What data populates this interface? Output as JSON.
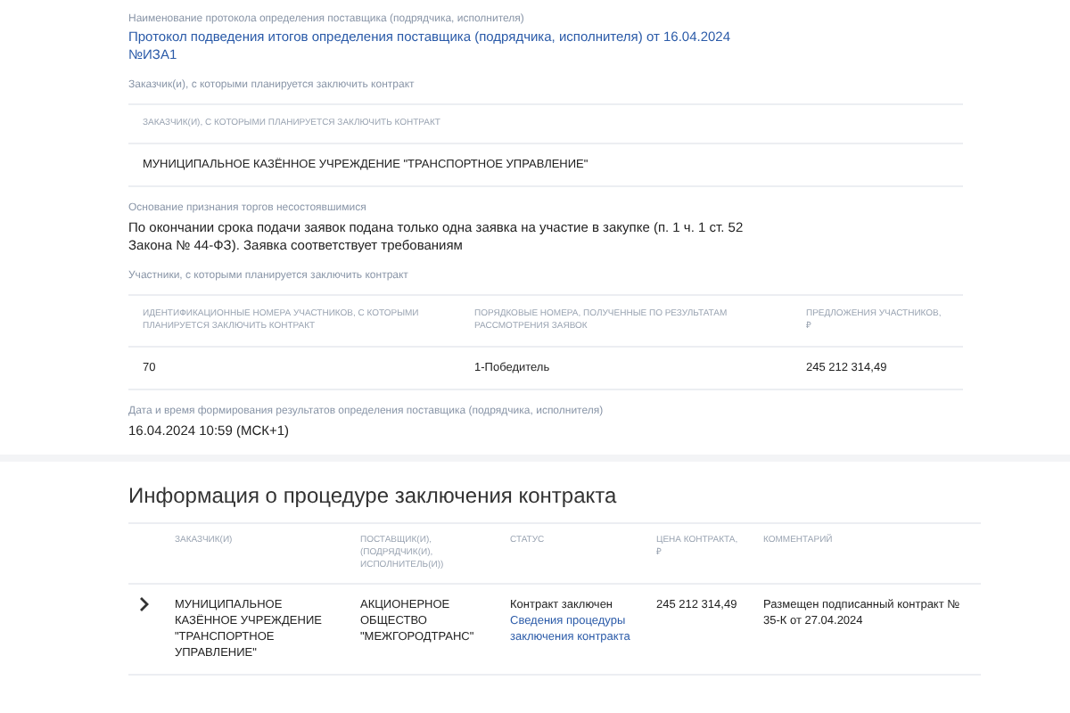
{
  "protocol": {
    "label": "Наименование протокола определения поставщика (подрядчика, исполнителя)",
    "link": "Протокол подведения итогов определения поставщика (подрядчика, исполнителя) от 16.04.2024 №ИЗА1"
  },
  "customers": {
    "label": "Заказчик(и), с которыми планируется заключить контракт",
    "columns": [
      "ЗАКАЗЧИК(И), С КОТОРЫМИ ПЛАНИРУЕТСЯ ЗАКЛЮЧИТЬ КОНТРАКТ"
    ],
    "rows": [
      [
        "МУНИЦИПАЛЬНОЕ КАЗЁННОЕ УЧРЕЖДЕНИЕ \"ТРАНСПОРТНОЕ УПРАВЛЕНИЕ\""
      ]
    ]
  },
  "reason": {
    "label": "Основание признания торгов несостоявшимися",
    "text": "По окончании срока подачи заявок подана только одна заявка на участие в закупке (п. 1 ч. 1 ст. 52 Закона № 44-ФЗ). Заявка соответствует требованиям"
  },
  "participants": {
    "label": "Участники, с которыми планируется заключить контракт",
    "columns": [
      "ИДЕНТИФИКАЦИОННЫЕ НОМЕРА УЧАСТНИКОВ, С КОТОРЫМИ ПЛАНИРУЕТСЯ ЗАКЛЮЧИТЬ КОНТРАКТ",
      "ПОРЯДКОВЫЕ НОМЕРА, ПОЛУЧЕННЫЕ ПО РЕЗУЛЬТАТАМ РАССМОТРЕНИЯ ЗАЯВОК",
      "ПРЕДЛОЖЕНИЯ УЧАСТНИКОВ, ₽"
    ],
    "rows": [
      [
        "70",
        "1-Победитель",
        "245 212 314,49"
      ]
    ]
  },
  "date": {
    "label": "Дата и время формирования результатов определения поставщика (подрядчика, исполнителя)",
    "value": "16.04.2024 10:59 (МСК+1)"
  },
  "contract": {
    "title": "Информация о процедуре заключения контракта",
    "columns": [
      "ЗАКАЗЧИК(И)",
      "ПОСТАВЩИК(И), (ПОДРЯДЧИК(И), ИСПОЛНИТЕЛЬ(И))",
      "СТАТУС",
      "ЦЕНА КОНТРАКТА, ₽",
      "КОММЕНТАРИЙ"
    ],
    "rows": [
      {
        "expanded": false,
        "customer": "МУНИЦИПАЛЬНОЕ КАЗЁННОЕ УЧРЕЖДЕНИЕ \"ТРАНСПОРТНОЕ УПРАВЛЕНИЕ\"",
        "supplier": "АКЦИОНЕРНОЕ ОБЩЕСТВО \"МЕЖГОРОДТРАНС\"",
        "status": "Контракт заключен",
        "status_link": "Сведения процедуры заключения контракта",
        "price": "245 212 314,49",
        "comment": "Размещен подписанный контракт № 35-К от 27.04.2024"
      }
    ]
  }
}
